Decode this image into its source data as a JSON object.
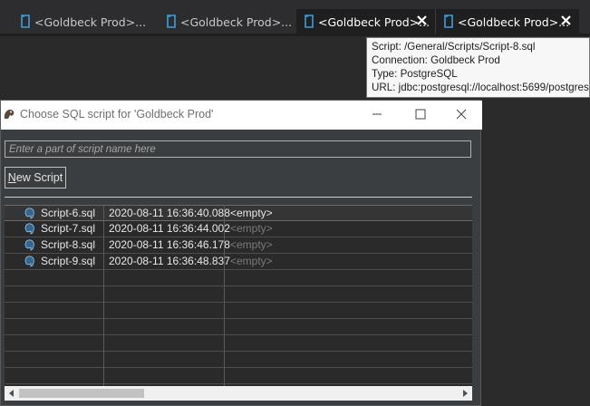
{
  "tabs": [
    {
      "label": "<Goldbeck Prod>...",
      "active": false
    },
    {
      "label": "<Goldbeck Prod>...",
      "active": false
    },
    {
      "label": "<Goldbeck Prod>...",
      "active": true
    },
    {
      "label": "<Goldbeck Prod>...",
      "active": false
    }
  ],
  "tooltip": {
    "script": "Script: /General/Scripts/Script-8.sql",
    "connection": "Connection: Goldbeck Prod",
    "type": "Type: PostgreSQL",
    "url": "URL: jdbc:postgresql://localhost:5699/postgres"
  },
  "dialog": {
    "title": "Choose SQL script for 'Goldbeck Prod'",
    "search_placeholder": "Enter a part of script name here",
    "new_script_prefix": "N",
    "new_script_rest": "ew Script",
    "rows": [
      {
        "name": "Script-6.sql",
        "date": "2020-08-11 16:36:40.088",
        "desc": "<empty>",
        "selected": true
      },
      {
        "name": "Script-7.sql",
        "date": "2020-08-11 16:36:44.002",
        "desc": "<empty>",
        "selected": false
      },
      {
        "name": "Script-8.sql",
        "date": "2020-08-11 16:36:46.178",
        "desc": "<empty>",
        "selected": false
      },
      {
        "name": "Script-9.sql",
        "date": "2020-08-11 16:36:48.837",
        "desc": "<empty>",
        "selected": false
      }
    ]
  },
  "colors": {
    "accent_icon": "#4aa3df",
    "dialog_bg": "#3b3e40",
    "tooltip_bg": "#f7f7f7"
  },
  "icons": {
    "tab": "sql-script-icon",
    "row": "postgresql-elephant-icon",
    "app": "dbeaver-beaver-icon"
  }
}
